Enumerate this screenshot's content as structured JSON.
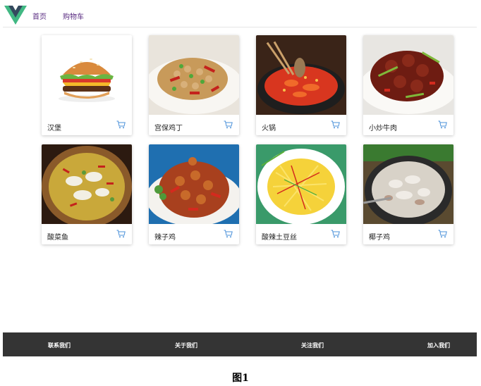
{
  "nav": {
    "logo_icon": "vue-logo-icon",
    "links": [
      "首页",
      "购物车"
    ],
    "link_color": "#5a2d82"
  },
  "products": [
    {
      "name": "汉堡",
      "image": "hamburger-image",
      "icon": "shopping-cart-icon"
    },
    {
      "name": "宫保鸡丁",
      "image": "kung-pao-chicken-image",
      "icon": "shopping-cart-icon"
    },
    {
      "name": "火锅",
      "image": "hot-pot-image",
      "icon": "shopping-cart-icon"
    },
    {
      "name": "小炒牛肉",
      "image": "stir-fried-beef-image",
      "icon": "shopping-cart-icon"
    },
    {
      "name": "酸菜鱼",
      "image": "pickled-cabbage-fish-image",
      "icon": "shopping-cart-icon"
    },
    {
      "name": "辣子鸡",
      "image": "spicy-chicken-image",
      "icon": "shopping-cart-icon"
    },
    {
      "name": "酸辣土豆丝",
      "image": "hot-sour-potato-shreds-image",
      "icon": "shopping-cart-icon"
    },
    {
      "name": "椰子鸡",
      "image": "coconut-chicken-image",
      "icon": "shopping-cart-icon"
    }
  ],
  "footer": {
    "links": [
      "联系我们",
      "关于我们",
      "关注我们",
      "加入我们"
    ],
    "background": "#343434"
  },
  "caption": "图1",
  "colors": {
    "cart_icon": "#4a90d9",
    "vue_green": "#41b883",
    "vue_dark": "#34495e"
  }
}
